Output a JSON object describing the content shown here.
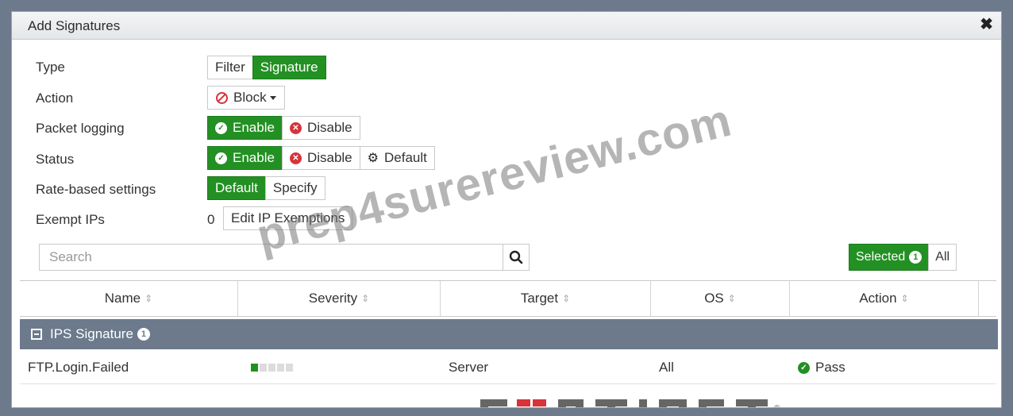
{
  "dialog": {
    "title": "Add Signatures"
  },
  "form": {
    "type": {
      "label": "Type",
      "options": [
        "Filter",
        "Signature"
      ],
      "selected": "Signature"
    },
    "action": {
      "label": "Action",
      "value": "Block"
    },
    "packet_logging": {
      "label": "Packet logging",
      "options": [
        "Enable",
        "Disable"
      ],
      "selected": "Enable"
    },
    "status": {
      "label": "Status",
      "options": [
        "Enable",
        "Disable",
        "Default"
      ],
      "selected": "Enable"
    },
    "rate_based": {
      "label": "Rate-based settings",
      "options": [
        "Default",
        "Specify"
      ],
      "selected": "Default"
    },
    "exempt_ips": {
      "label": "Exempt IPs",
      "count": "0",
      "button": "Edit IP Exemptions"
    }
  },
  "search": {
    "placeholder": "Search"
  },
  "filter": {
    "selected_label": "Selected",
    "selected_count": "1",
    "all_label": "All"
  },
  "table": {
    "columns": [
      "Name",
      "Severity",
      "Target",
      "OS",
      "Action"
    ],
    "group": {
      "label": "IPS Signature",
      "count": "1"
    },
    "rows": [
      {
        "name": "FTP.Login.Failed",
        "severity_level": 1,
        "severity_max": 5,
        "target": "Server",
        "os": "All",
        "action": "Pass"
      }
    ]
  },
  "watermark": "prep4surereview.com",
  "brand_logo": "FORTINET",
  "colors": {
    "accent": "#239023",
    "group_header": "#6c7a8c",
    "danger": "#d8323a"
  }
}
